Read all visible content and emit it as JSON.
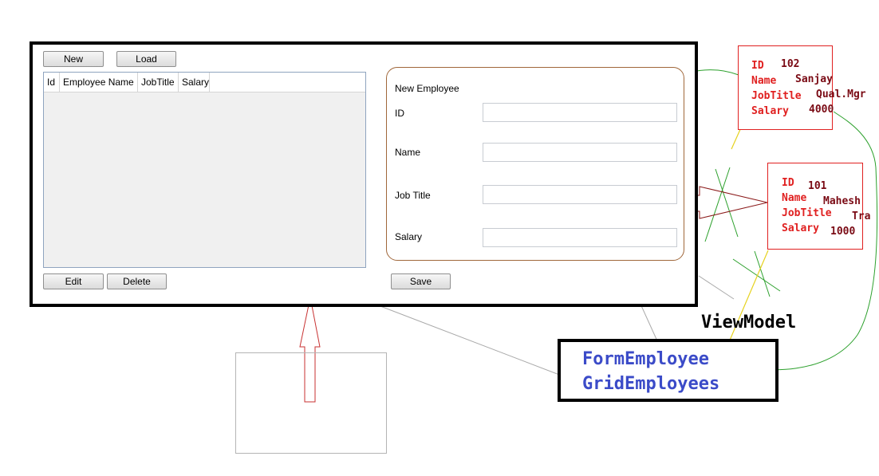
{
  "window": {
    "buttons": {
      "new": "New",
      "load": "Load",
      "edit": "Edit",
      "delete": "Delete",
      "save": "Save"
    },
    "grid": {
      "columns": [
        "Id",
        "Employee Name",
        "JobTitle",
        "Salary"
      ]
    },
    "form": {
      "title": "New Employee",
      "labels": {
        "id": "ID",
        "name": "Name",
        "job_title": "Job Title",
        "salary": "Salary"
      }
    }
  },
  "objects": [
    {
      "keys": {
        "id": "ID",
        "name": "Name",
        "job_title": "JobTitle",
        "salary": "Salary"
      },
      "values": {
        "id": "102",
        "name": "Sanjay",
        "job_title": "Qual.Mgr",
        "salary": "4000"
      }
    },
    {
      "keys": {
        "id": "ID",
        "name": "Name",
        "job_title": "JobTitle",
        "salary": "Salary"
      },
      "values": {
        "id": "101",
        "name": "Mahesh",
        "job_title": "Tra",
        "salary": "1000"
      }
    }
  ],
  "viewmodel": {
    "title": "ViewModel",
    "properties": [
      "FormEmployee",
      "GridEmployees"
    ]
  },
  "colors": {
    "annotation_key": "#e02020",
    "annotation_value": "#7a0a14",
    "viewmodel_property": "#3b4bc8",
    "connector_green": "#2ca02c",
    "connector_yellow": "#e6d21e",
    "arrow_red": "#c83232"
  }
}
